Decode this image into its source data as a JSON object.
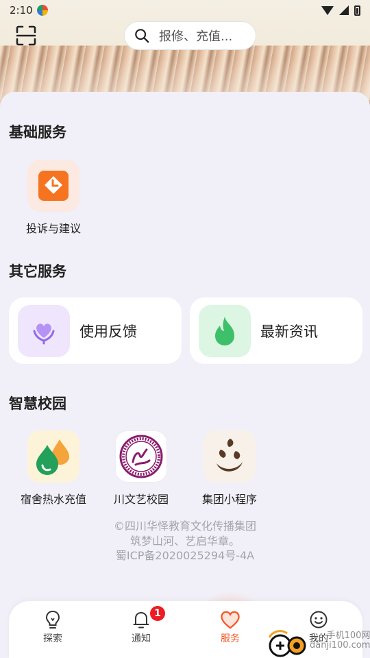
{
  "status_bar": {
    "time": "2:10"
  },
  "header": {
    "search_placeholder": "报修、充值..."
  },
  "sections": {
    "basic": {
      "title": "基础服务",
      "items": [
        {
          "label": "投诉与建议",
          "icon": "complaint-icon",
          "color": "#f6731f"
        }
      ]
    },
    "other": {
      "title": "其它服务",
      "cards": [
        {
          "label": "使用反馈",
          "icon": "heart-hands-icon",
          "color": "#a07af2"
        },
        {
          "label": "最新资讯",
          "icon": "flame-icon",
          "color": "#3ec06a"
        }
      ]
    },
    "campus": {
      "title": "智慧校园",
      "items": [
        {
          "label": "宿舍热水充值",
          "icon": "water-drop-icon"
        },
        {
          "label": "川文艺校园",
          "icon": "university-seal-icon"
        },
        {
          "label": "集团小程序",
          "icon": "group-logo-icon"
        }
      ]
    }
  },
  "footer": {
    "line1": "©四川华怿教育文化传播集团",
    "line2": "筑梦山河、艺启华章。",
    "line3": "蜀ICP备2020025294号-4A"
  },
  "bottom_nav": {
    "items": [
      {
        "label": "探索",
        "icon": "lightbulb-icon"
      },
      {
        "label": "通知",
        "icon": "bell-icon",
        "badge": "1"
      },
      {
        "label": "服务",
        "icon": "heart-icon",
        "active": true
      },
      {
        "label": "我的",
        "icon": "smile-face-icon"
      }
    ],
    "accent_color": "#f25b2a"
  },
  "watermark": {
    "line1": "手机100网",
    "line2": "danji100.com"
  }
}
